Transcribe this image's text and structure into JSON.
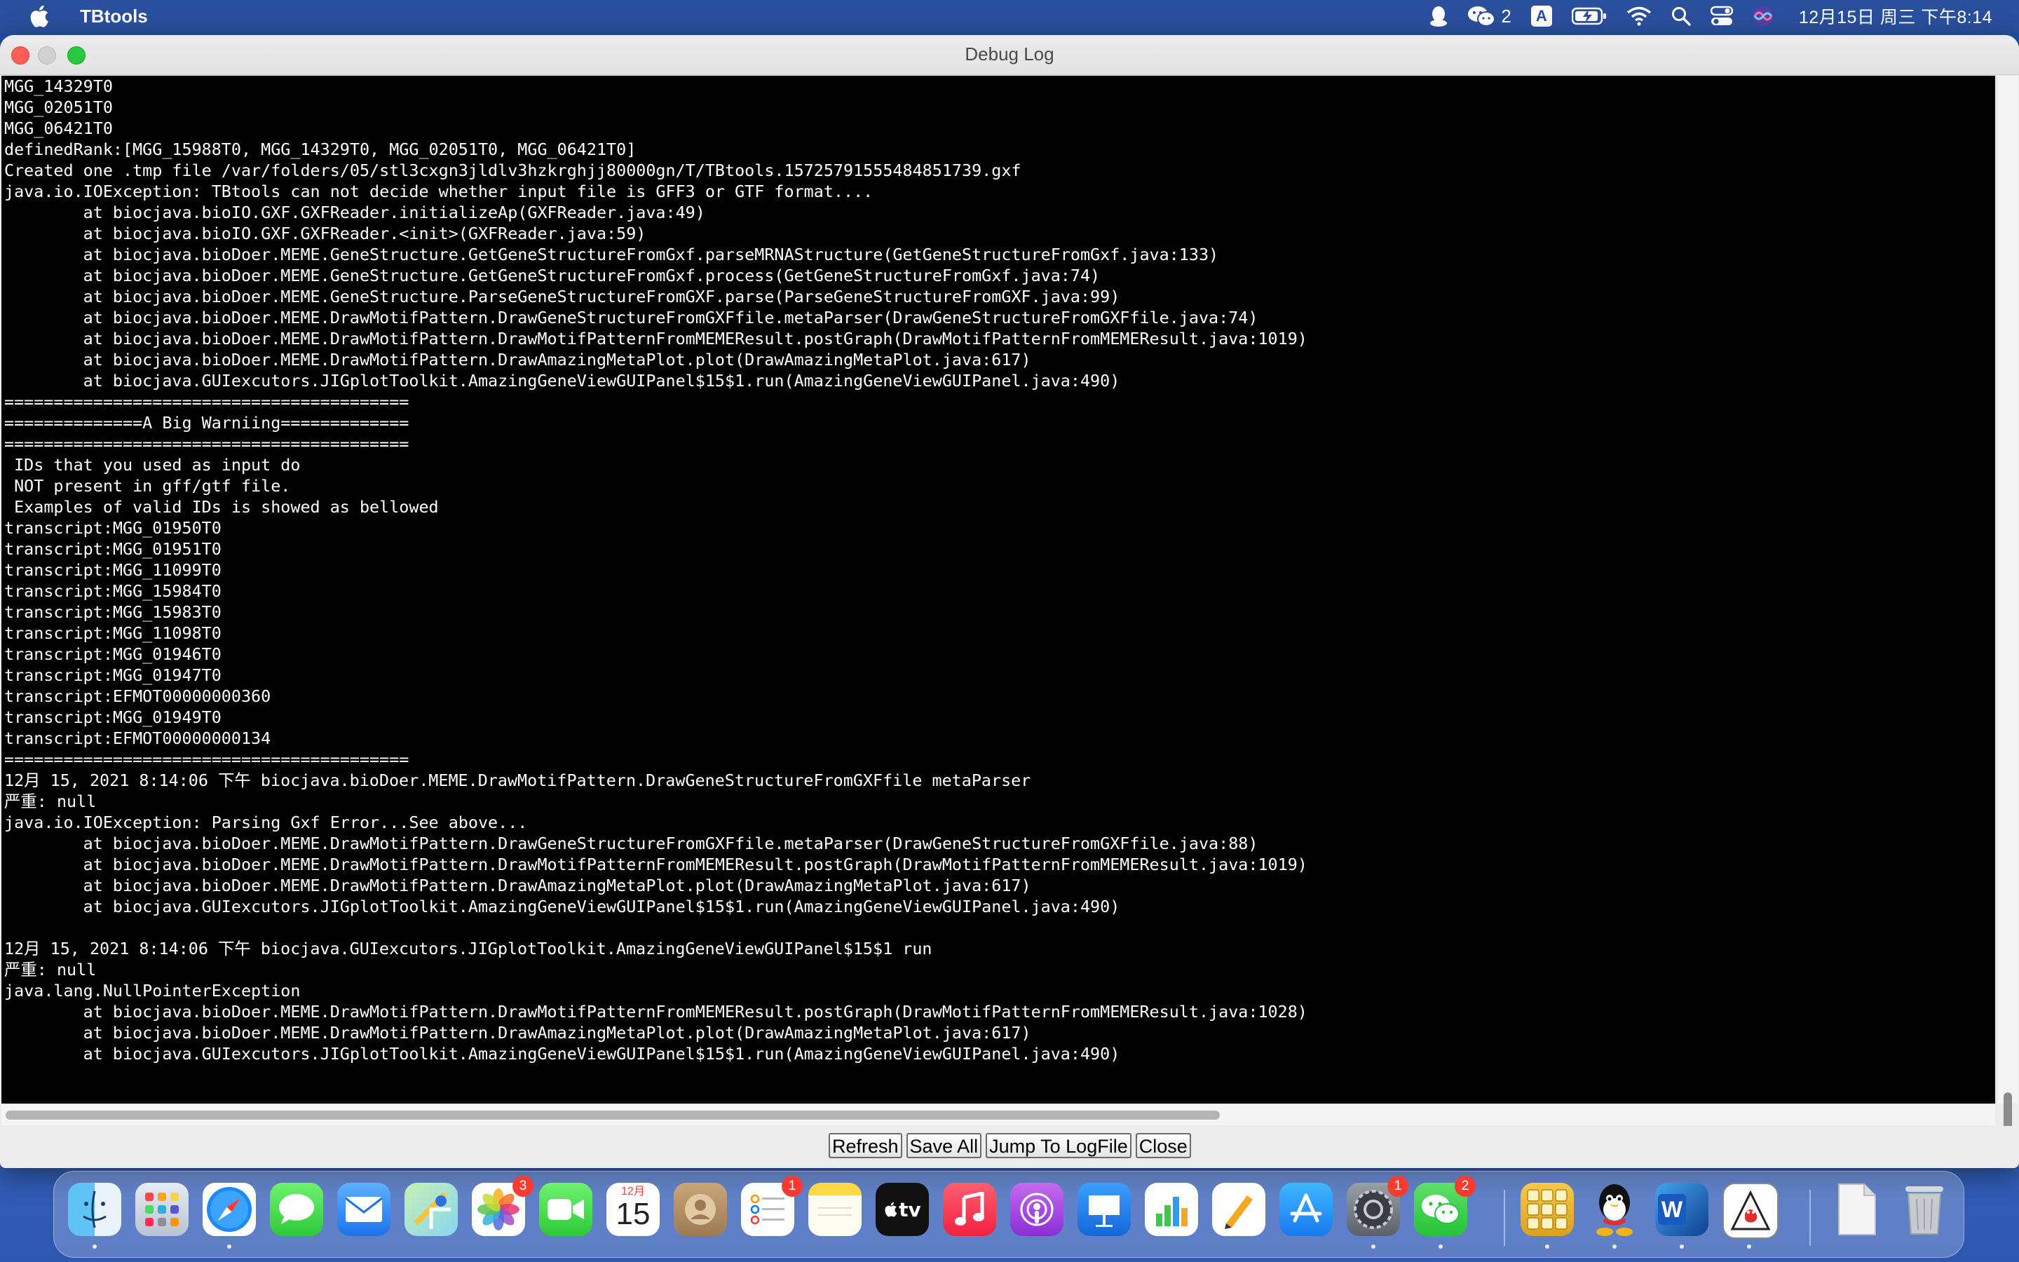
{
  "menubar": {
    "app_name": "TBtools",
    "wechat_count": "2",
    "input_source": "A",
    "clock": "12月15日 周三 下午8:14",
    "icons": [
      "apple-icon",
      "qq-icon",
      "wechat-icon",
      "input-source-icon",
      "battery-icon",
      "wifi-icon",
      "spotlight-icon",
      "control-center-icon",
      "siri-icon"
    ]
  },
  "window": {
    "title": "Debug Log",
    "log_lines": [
      "MGG_14329T0",
      "MGG_02051T0",
      "MGG_06421T0",
      "definedRank:[MGG_15988T0, MGG_14329T0, MGG_02051T0, MGG_06421T0]",
      "Created one .tmp file /var/folders/05/stl3cxgn3jldlv3hzkrghjj80000gn/T/TBtools.15725791555484851739.gxf",
      "java.io.IOException: TBtools can not decide whether input file is GFF3 or GTF format....",
      "\tat biocjava.bioIO.GXF.GXFReader.initializeAp(GXFReader.java:49)",
      "\tat biocjava.bioIO.GXF.GXFReader.<init>(GXFReader.java:59)",
      "\tat biocjava.bioDoer.MEME.GeneStructure.GetGeneStructureFromGxf.parseMRNAStructure(GetGeneStructureFromGxf.java:133)",
      "\tat biocjava.bioDoer.MEME.GeneStructure.GetGeneStructureFromGxf.process(GetGeneStructureFromGxf.java:74)",
      "\tat biocjava.bioDoer.MEME.GeneStructure.ParseGeneStructureFromGXF.parse(ParseGeneStructureFromGXF.java:99)",
      "\tat biocjava.bioDoer.MEME.DrawMotifPattern.DrawGeneStructureFromGXFfile.metaParser(DrawGeneStructureFromGXFfile.java:74)",
      "\tat biocjava.bioDoer.MEME.DrawMotifPattern.DrawMotifPatternFromMEMEResult.postGraph(DrawMotifPatternFromMEMEResult.java:1019)",
      "\tat biocjava.bioDoer.MEME.DrawMotifPattern.DrawAmazingMetaPlot.plot(DrawAmazingMetaPlot.java:617)",
      "\tat biocjava.GUIexcutors.JIGplotToolkit.AmazingGeneViewGUIPanel$15$1.run(AmazingGeneViewGUIPanel.java:490)",
      "=========================================",
      "==============A Big Warniing=============",
      "=========================================",
      " IDs that you used as input do",
      " NOT present in gff/gtf file.",
      " Examples of valid IDs is showed as bellowed",
      "transcript:MGG_01950T0",
      "transcript:MGG_01951T0",
      "transcript:MGG_11099T0",
      "transcript:MGG_15984T0",
      "transcript:MGG_15983T0",
      "transcript:MGG_11098T0",
      "transcript:MGG_01946T0",
      "transcript:MGG_01947T0",
      "transcript:EFMOT00000000360",
      "transcript:MGG_01949T0",
      "transcript:EFMOT00000000134",
      "=========================================",
      "12月 15, 2021 8:14:06 下午 biocjava.bioDoer.MEME.DrawMotifPattern.DrawGeneStructureFromGXFfile metaParser",
      "严重: null",
      "java.io.IOException: Parsing Gxf Error...See above...",
      "\tat biocjava.bioDoer.MEME.DrawMotifPattern.DrawGeneStructureFromGXFfile.metaParser(DrawGeneStructureFromGXFfile.java:88)",
      "\tat biocjava.bioDoer.MEME.DrawMotifPattern.DrawMotifPatternFromMEMEResult.postGraph(DrawMotifPatternFromMEMEResult.java:1019)",
      "\tat biocjava.bioDoer.MEME.DrawMotifPattern.DrawAmazingMetaPlot.plot(DrawAmazingMetaPlot.java:617)",
      "\tat biocjava.GUIexcutors.JIGplotToolkit.AmazingGeneViewGUIPanel$15$1.run(AmazingGeneViewGUIPanel.java:490)",
      "",
      "12月 15, 2021 8:14:06 下午 biocjava.GUIexcutors.JIGplotToolkit.AmazingGeneViewGUIPanel$15$1 run",
      "严重: null",
      "java.lang.NullPointerException",
      "\tat biocjava.bioDoer.MEME.DrawMotifPattern.DrawMotifPatternFromMEMEResult.postGraph(DrawMotifPatternFromMEMEResult.java:1028)",
      "\tat biocjava.bioDoer.MEME.DrawMotifPattern.DrawAmazingMetaPlot.plot(DrawAmazingMetaPlot.java:617)",
      "\tat biocjava.GUIexcutors.JIGplotToolkit.AmazingGeneViewGUIPanel$15$1.run(AmazingGeneViewGUIPanel.java:490)"
    ],
    "buttons": {
      "refresh": "Refresh",
      "save_all": "Save All",
      "jump_to_logfile": "Jump To LogFile",
      "close": "Close"
    }
  },
  "dock": {
    "apps": [
      {
        "name": "finder",
        "running": true
      },
      {
        "name": "launchpad",
        "running": false
      },
      {
        "name": "safari",
        "running": true
      },
      {
        "name": "messages",
        "running": false
      },
      {
        "name": "mail",
        "running": false
      },
      {
        "name": "maps",
        "running": false
      },
      {
        "name": "photos",
        "running": false,
        "badge": "3"
      },
      {
        "name": "facetime",
        "running": false
      },
      {
        "name": "calendar",
        "running": false,
        "month": "12月",
        "day": "15"
      },
      {
        "name": "contacts",
        "running": false
      },
      {
        "name": "reminders",
        "running": false,
        "badge": "1"
      },
      {
        "name": "notes",
        "running": false
      },
      {
        "name": "apple-tv",
        "running": false,
        "label": "tv"
      },
      {
        "name": "music",
        "running": false
      },
      {
        "name": "podcasts",
        "running": false
      },
      {
        "name": "keynote",
        "running": false
      },
      {
        "name": "numbers",
        "running": false
      },
      {
        "name": "pages",
        "running": false
      },
      {
        "name": "app-store",
        "running": false
      },
      {
        "name": "system-preferences",
        "running": true,
        "badge": "1"
      },
      {
        "name": "wechat",
        "running": true,
        "badge": "2"
      },
      {
        "name": "tbtools",
        "running": true
      },
      {
        "name": "qq",
        "running": true
      },
      {
        "name": "word",
        "running": true,
        "label": "W"
      },
      {
        "name": "java",
        "running": true
      },
      {
        "name": "documents-stack",
        "running": false
      },
      {
        "name": "trash",
        "running": false
      }
    ]
  }
}
